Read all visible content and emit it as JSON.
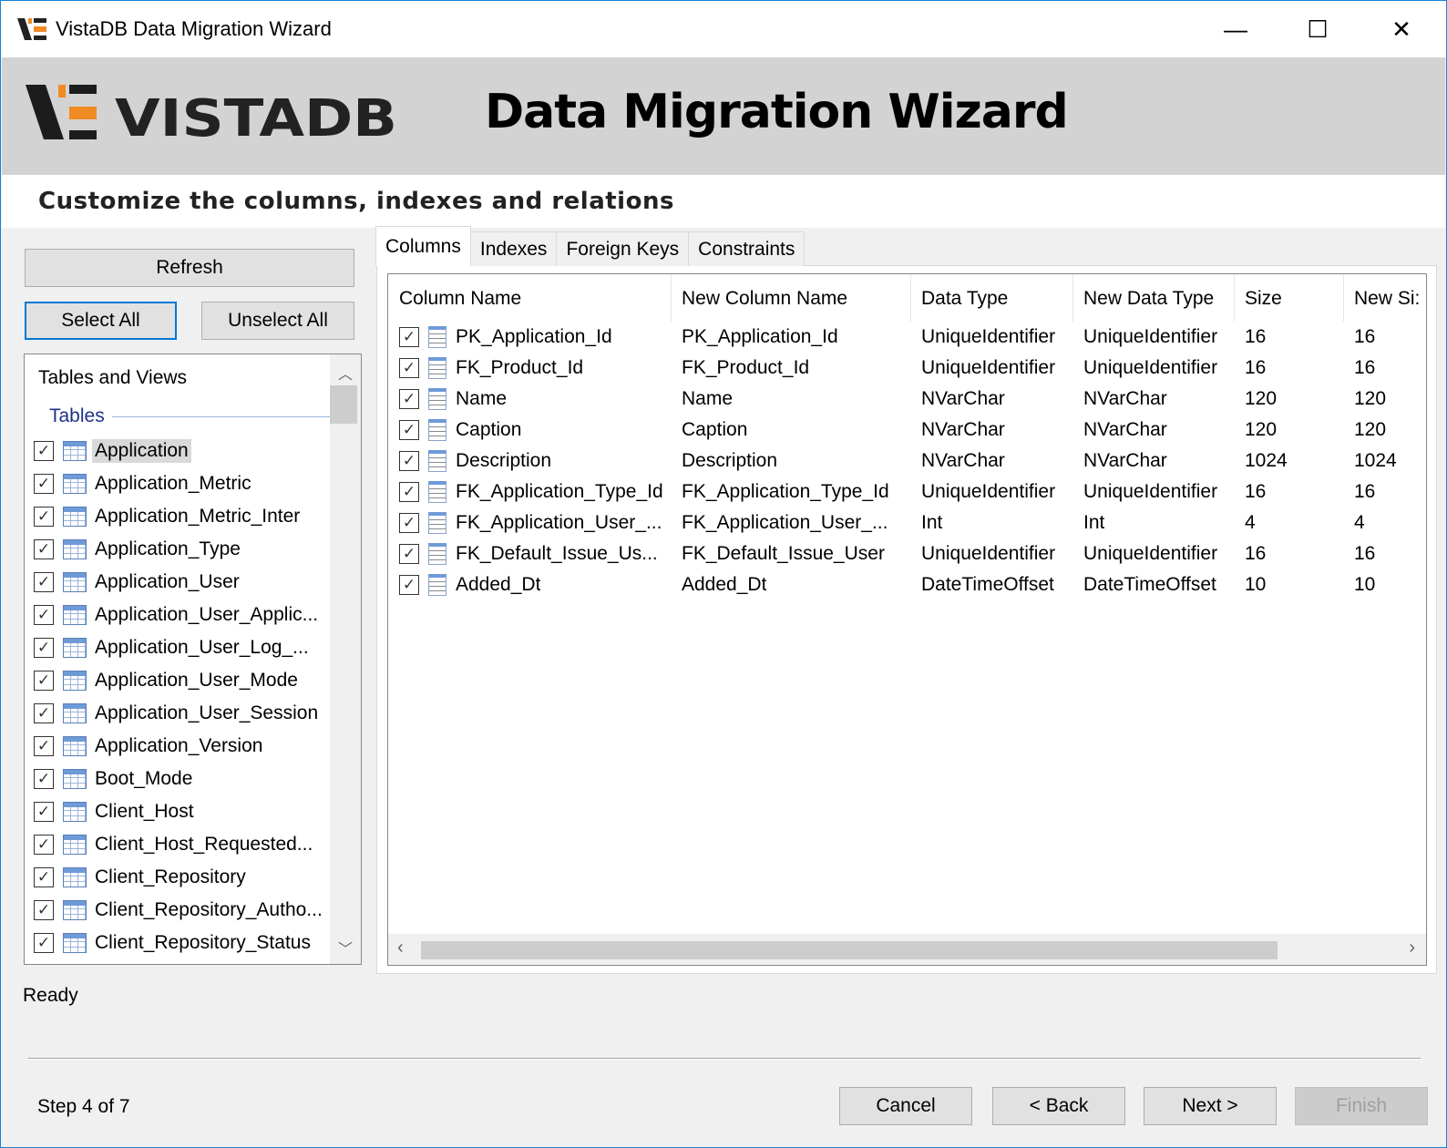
{
  "window": {
    "title": "VistaDB Data Migration Wizard",
    "min": "—",
    "max": "☐",
    "close": "✕"
  },
  "banner": {
    "logo_text": "VISTADB",
    "title": "Data Migration Wizard"
  },
  "subtitle": "Customize the columns, indexes and relations",
  "left": {
    "refresh": "Refresh",
    "select_all": "Select All",
    "unselect_all": "Unselect All",
    "list_header": "Tables and Views",
    "group": "Tables",
    "items": [
      "Application",
      "Application_Metric",
      "Application_Metric_Inter",
      "Application_Type",
      "Application_User",
      "Application_User_Applic...",
      "Application_User_Log_...",
      "Application_User_Mode",
      "Application_User_Session",
      "Application_Version",
      "Boot_Mode",
      "Client_Host",
      "Client_Host_Requested...",
      "Client_Repository",
      "Client_Repository_Autho...",
      "Client_Repository_Status"
    ]
  },
  "tabs": [
    "Columns",
    "Indexes",
    "Foreign Keys",
    "Constraints"
  ],
  "grid": {
    "headers": [
      "Column Name",
      "New Column Name",
      "Data Type",
      "New Data Type",
      "Size",
      "New Si:"
    ],
    "rows": [
      [
        "PK_Application_Id",
        "PK_Application_Id",
        "UniqueIdentifier",
        "UniqueIdentifier",
        "16",
        "16"
      ],
      [
        "FK_Product_Id",
        "FK_Product_Id",
        "UniqueIdentifier",
        "UniqueIdentifier",
        "16",
        "16"
      ],
      [
        "Name",
        "Name",
        "NVarChar",
        "NVarChar",
        "120",
        "120"
      ],
      [
        "Caption",
        "Caption",
        "NVarChar",
        "NVarChar",
        "120",
        "120"
      ],
      [
        "Description",
        "Description",
        "NVarChar",
        "NVarChar",
        "1024",
        "1024"
      ],
      [
        "FK_Application_Type_Id",
        "FK_Application_Type_Id",
        "UniqueIdentifier",
        "UniqueIdentifier",
        "16",
        "16"
      ],
      [
        "FK_Application_User_...",
        "FK_Application_User_...",
        "Int",
        "Int",
        "4",
        "4"
      ],
      [
        "FK_Default_Issue_Us...",
        "FK_Default_Issue_User",
        "UniqueIdentifier",
        "UniqueIdentifier",
        "16",
        "16"
      ],
      [
        "Added_Dt",
        "Added_Dt",
        "DateTimeOffset",
        "DateTimeOffset",
        "10",
        "10"
      ]
    ]
  },
  "status": "Ready",
  "footer": {
    "step": "Step 4 of 7",
    "cancel": "Cancel",
    "back": "< Back",
    "next": "Next >",
    "finish": "Finish"
  }
}
